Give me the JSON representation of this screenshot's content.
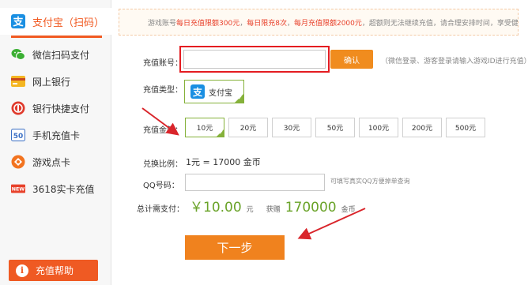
{
  "sidebar": {
    "items": [
      {
        "label": "支付宝（扫码）",
        "icon": "alipay-icon",
        "active": true
      },
      {
        "label": "微信扫码支付",
        "icon": "wechat-icon"
      },
      {
        "label": "网上银行",
        "icon": "bank-card-icon"
      },
      {
        "label": "银行快捷支付",
        "icon": "quick-pay-icon"
      },
      {
        "label": "手机充值卡",
        "icon": "phone-card-icon"
      },
      {
        "label": "游戏点卡",
        "icon": "game-card-icon"
      },
      {
        "label": "3618实卡充值",
        "icon": "new-card-icon"
      }
    ],
    "help_label": "充值帮助"
  },
  "notice": {
    "prefix": "游戏账号",
    "day_limit": "每日充值限额300元",
    "sep1": "，",
    "count_limit": "每日限充8次",
    "sep2": "，",
    "month_limit": "每月充值限额2000元",
    "suffix": "，超额则无法继续充值，请合理安排时间，享受健康生活。"
  },
  "form": {
    "account_label": "充值账号：",
    "account_value": "",
    "confirm_label": "确认",
    "confirm_hint": "（微信登录、游客登录请输入游戏ID进行充值）",
    "type_label": "充值类型：",
    "type_value": "支付宝",
    "amount_label": "充值金额：",
    "amounts": [
      "10元",
      "20元",
      "30元",
      "50元",
      "100元",
      "200元",
      "500元"
    ],
    "selected_amount_index": 0,
    "rate_label": "兑换比例：",
    "rate_value": "1元 = 17000 金币",
    "qq_label": "QQ号码：",
    "qq_value": "",
    "qq_hint": "可填写真实QQ方便掉单查询",
    "total_label": "总计需支付：",
    "total_price": "￥10.00",
    "total_unit": "元",
    "gift_label": "获赠",
    "gift_value": "170000",
    "gift_unit": "金币",
    "next_label": "下一步"
  },
  "colors": {
    "accent_orange": "#f0821e",
    "highlight_red": "#e41c21",
    "price_green": "#6aa329",
    "select_green": "#85b13a"
  }
}
